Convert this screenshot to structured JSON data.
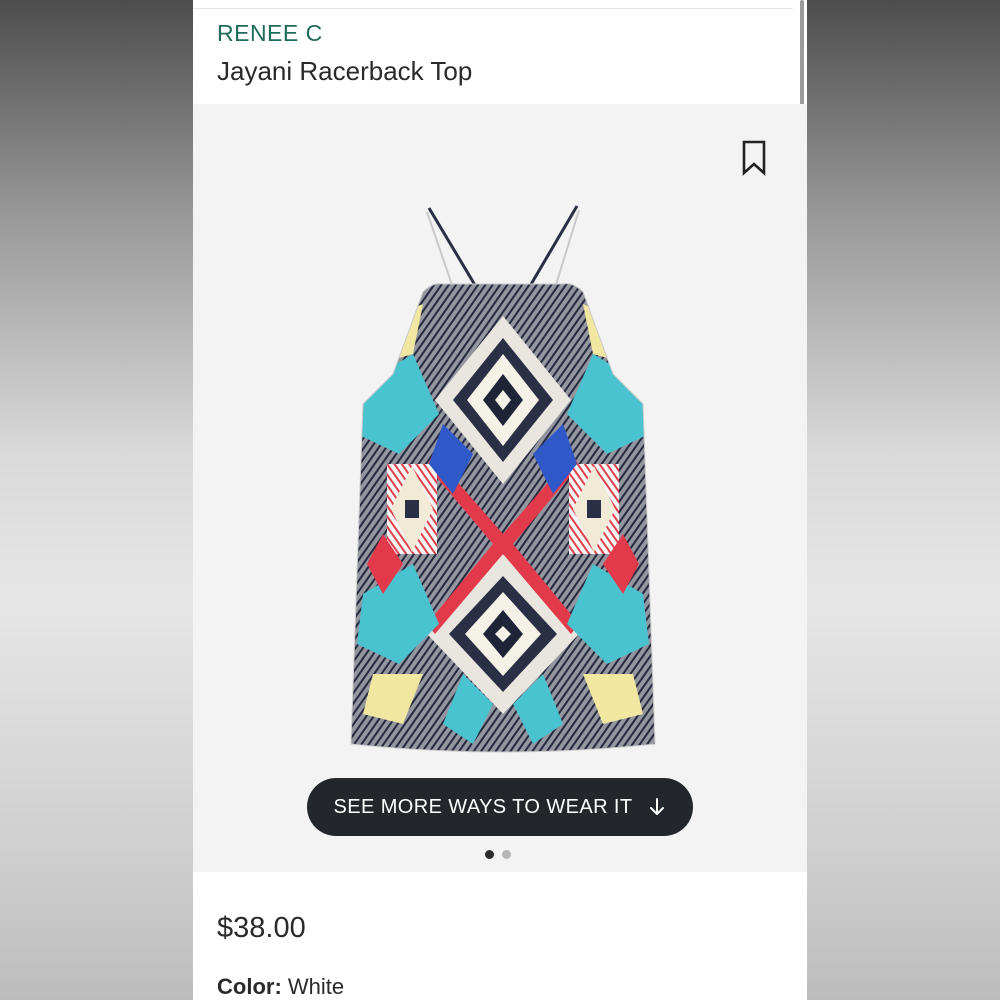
{
  "product": {
    "brand": "RENEE C",
    "title": "Jayani Racerback Top",
    "price": "$38.00",
    "color_label": "Color:",
    "color_value": "White"
  },
  "gallery": {
    "cta_label": "SEE MORE WAYS TO WEAR IT",
    "cta_icon": "arrow-down-icon",
    "bookmark_icon": "bookmark-icon",
    "dots": [
      {
        "active": true
      },
      {
        "active": false
      }
    ]
  },
  "colors": {
    "brand": "#1f6b5c",
    "cta_background": "#23272c",
    "image_background": "#f3f3f3"
  }
}
